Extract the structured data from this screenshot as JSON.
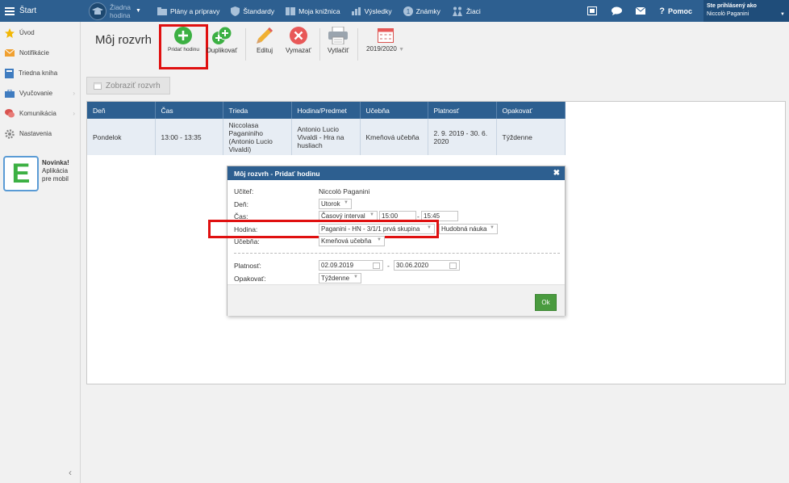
{
  "topbar": {
    "start_label": "Štart",
    "hodina_line1": "Žiadna",
    "hodina_line2": "hodina",
    "nav": [
      {
        "label": "Plány a prípravy",
        "icon": "folder-icon"
      },
      {
        "label": "Štandardy",
        "icon": "shield-icon"
      },
      {
        "label": "Moja knižnica",
        "icon": "book-icon"
      },
      {
        "label": "Výsledky",
        "icon": "chart-icon"
      },
      {
        "label": "Známky",
        "icon": "grade-icon"
      },
      {
        "label": "Žiaci",
        "icon": "students-icon"
      }
    ],
    "help_label": "Pomoc",
    "user_caption": "Ste prihlásený ako",
    "user_name": "Niccolò Paganini"
  },
  "sidebar": {
    "items": [
      {
        "label": "Úvod",
        "icon": "star-icon"
      },
      {
        "label": "Notifikácie",
        "icon": "envelope-icon"
      },
      {
        "label": "Triedna kniha",
        "icon": "book-icon"
      },
      {
        "label": "Vyučovanie",
        "icon": "briefcase-icon"
      },
      {
        "label": "Komunikácia",
        "icon": "chat-icon"
      },
      {
        "label": "Nastavenia",
        "icon": "gear-icon"
      }
    ],
    "promo_title": "Novinka!",
    "promo_line1": "Aplikácia",
    "promo_line2": "pre mobil",
    "promo_letter": "E"
  },
  "toolbar": {
    "page_title": "Môj rozvrh",
    "add_label": "Pridať hodinu",
    "duplicate_label": "Duplikovať",
    "edit_label": "Edituj",
    "delete_label": "Vymazať",
    "print_label": "Vytlačiť",
    "year_label": "2019/2020",
    "show_schedule_label": "Zobraziť rozvrh"
  },
  "table": {
    "headers": [
      "Deň",
      "Čas",
      "Trieda",
      "Hodina/Predmet",
      "Učebňa",
      "Platnosť",
      "Opakovať"
    ],
    "rows": [
      {
        "den": "Pondelok",
        "cas": "13:00 - 13:35",
        "trieda": [
          "Niccolasa",
          "Paganiniho",
          "(Antonio Lucio",
          "Vivaldi)"
        ],
        "hodina": [
          "Antonio Lucio",
          "Vivaldi - Hra na",
          "husliach"
        ],
        "ucebna": "Kmeňová učebňa",
        "platnost": [
          "2. 9. 2019 - 30. 6.",
          "2020"
        ],
        "opakovat": "Týždenne"
      }
    ]
  },
  "modal": {
    "title": "Môj rozvrh - Pridať hodinu",
    "close_glyph": "✖",
    "ucitel_label": "Učiteľ:",
    "ucitel_value": "Niccolò Paganini",
    "den_label": "Deň:",
    "den_value": "Utorok",
    "cas_label": "Čas:",
    "cas_type": "Časový interval",
    "cas_from": "15:00",
    "cas_dash": "-",
    "cas_to": "15:45",
    "hodina_label": "Hodina:",
    "hodina_value": "Paganini - HN - 3/1/1 prvá skupina",
    "predmet_value": "Hudobná náuka",
    "ucebna_label": "Učebňa:",
    "ucebna_value": "Kmeňová učebňa",
    "platnost_label": "Platnosť:",
    "platnost_from": "02.09.2019",
    "platnost_dash": "-",
    "platnost_to": "30.06.2020",
    "opakovat_label": "Opakovať:",
    "opakovat_value": "Týždenne",
    "ok_label": "Ok"
  },
  "colors": {
    "topbar": "#2d5f90",
    "highlight": "#e01010",
    "ok": "#4a9b3f"
  }
}
